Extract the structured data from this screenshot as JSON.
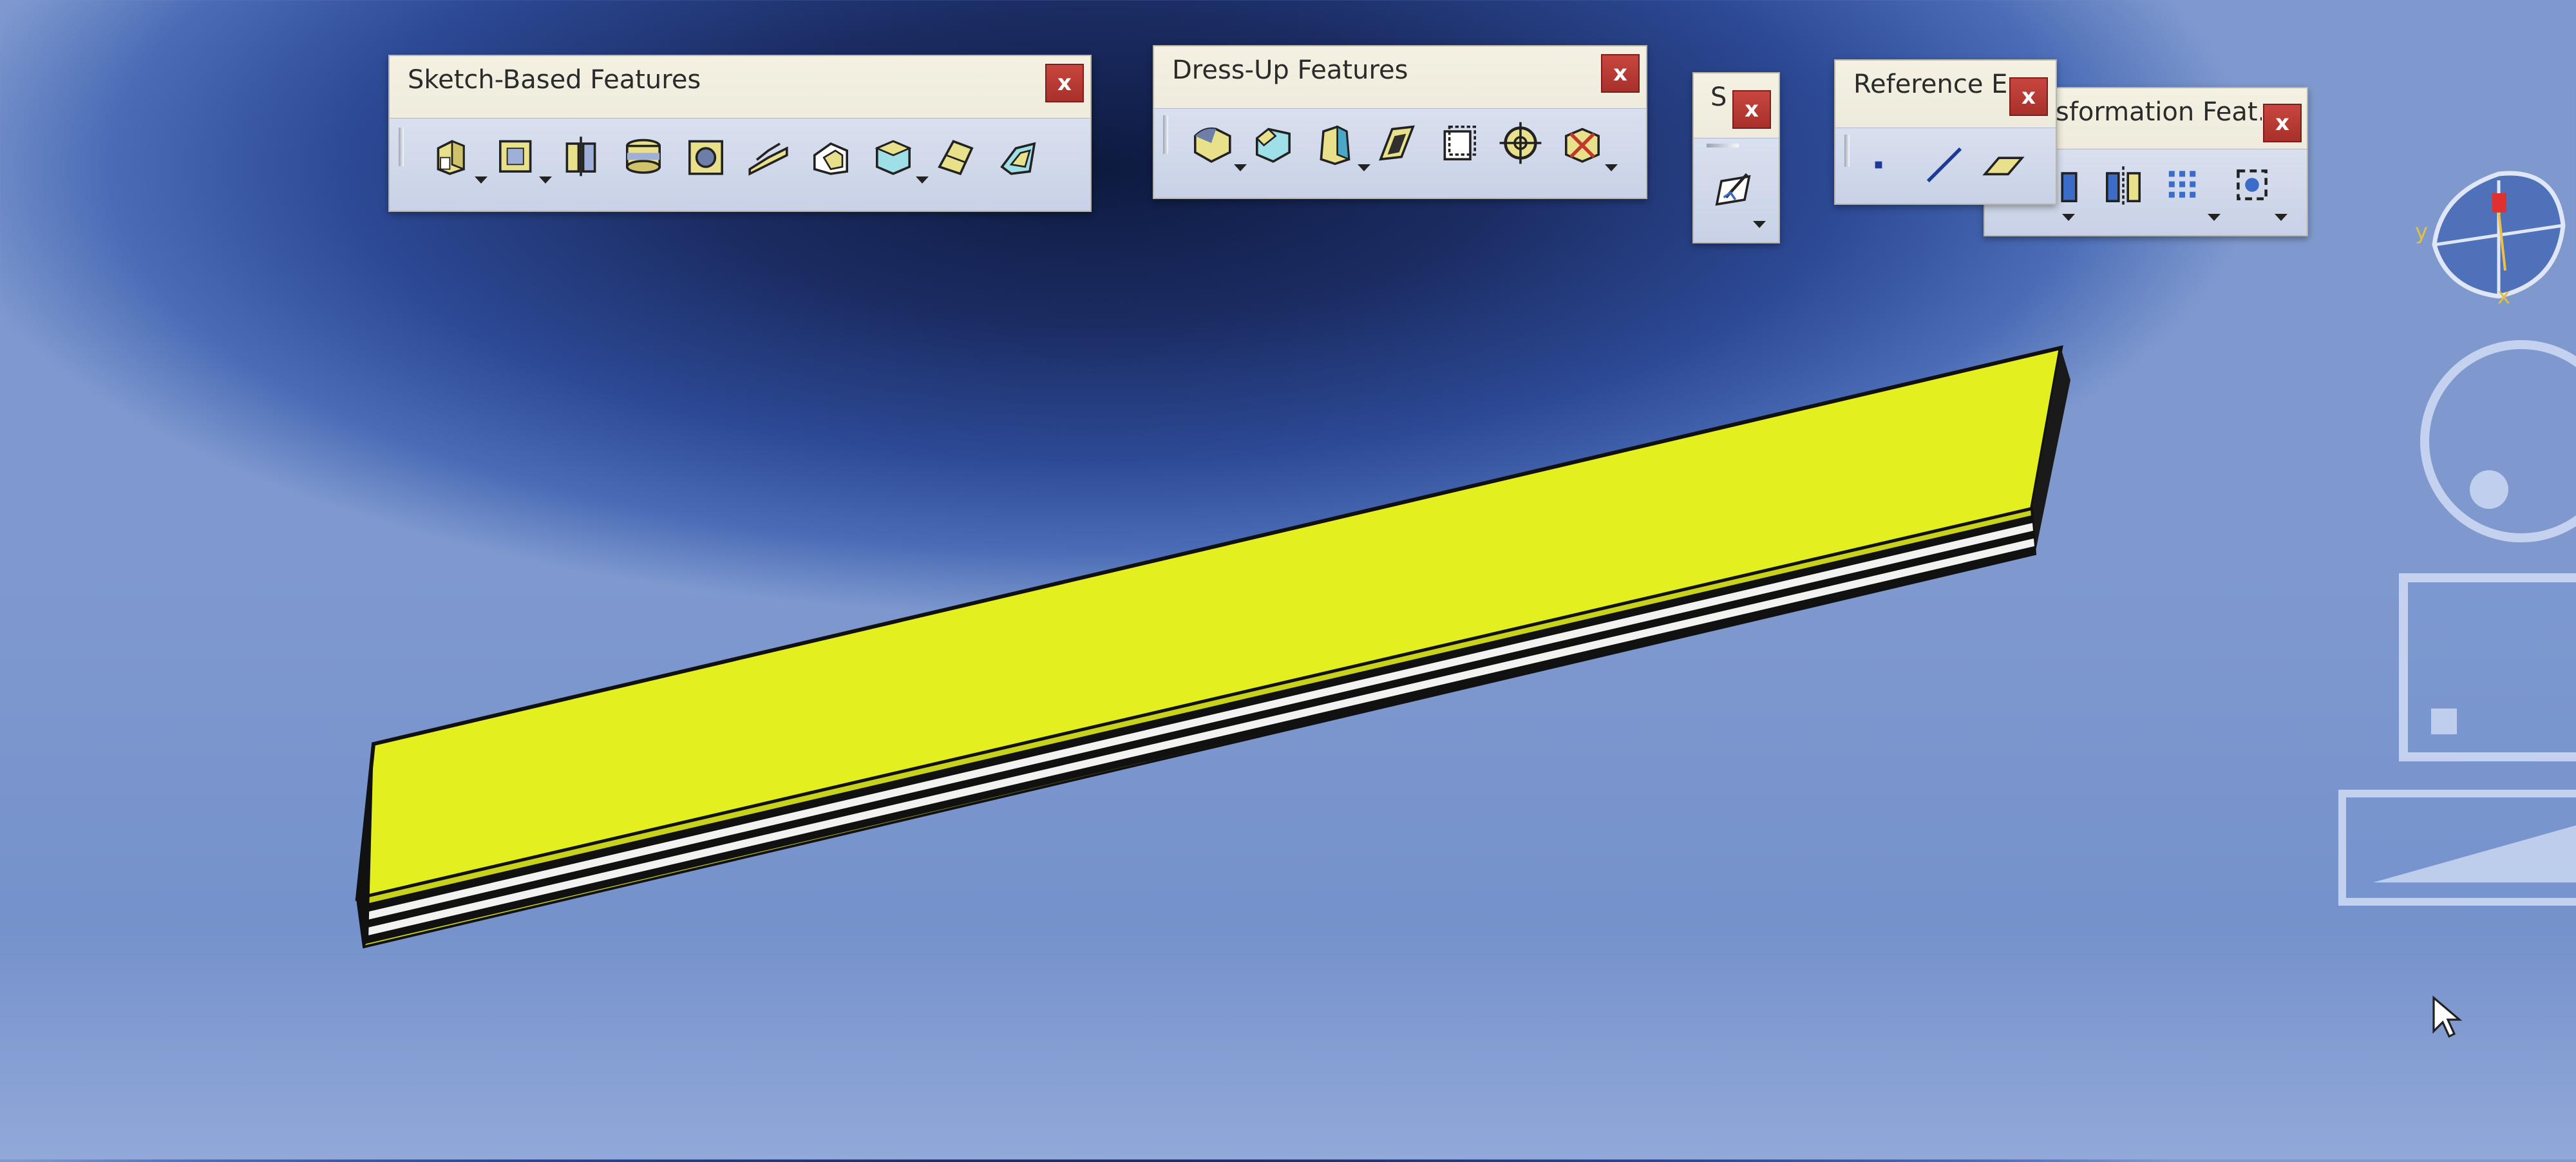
{
  "toolbars": {
    "sketch": {
      "title": "Sketch-Based Features",
      "close": "x",
      "buttons": [
        "pad-icon",
        "pocket-icon",
        "shaft-icon",
        "groove-icon",
        "hole-icon",
        "rib-icon",
        "slot-icon",
        "solid-combine-icon",
        "multi-section-solid-icon",
        "removed-multi-section-icon"
      ]
    },
    "dressup": {
      "title": "Dress-Up Features",
      "close": "x",
      "buttons": [
        "edge-fillet-icon",
        "chamfer-icon",
        "draft-icon",
        "shell-icon",
        "thickness-icon",
        "thread-icon",
        "remove-face-icon"
      ]
    },
    "sketcher": {
      "title": "S",
      "close": "x",
      "buttons": [
        "sketch-icon"
      ]
    },
    "reference": {
      "title": "Reference E...",
      "close": "x",
      "buttons": [
        "point-icon",
        "line-icon",
        "plane-icon"
      ]
    },
    "transformation": {
      "title": "sformation Feat...",
      "close": "x",
      "buttons": [
        "translation-icon",
        "mirror-icon",
        "rectangular-pattern-icon",
        "scaling-icon"
      ]
    }
  },
  "compass": {
    "axis_y": "y",
    "axis_x": "x"
  },
  "colors": {
    "part_face": "#e3ef1f",
    "part_edge": "#111111",
    "toolbar_bg": "#e6e3d5",
    "close_button": "#b3342e"
  }
}
